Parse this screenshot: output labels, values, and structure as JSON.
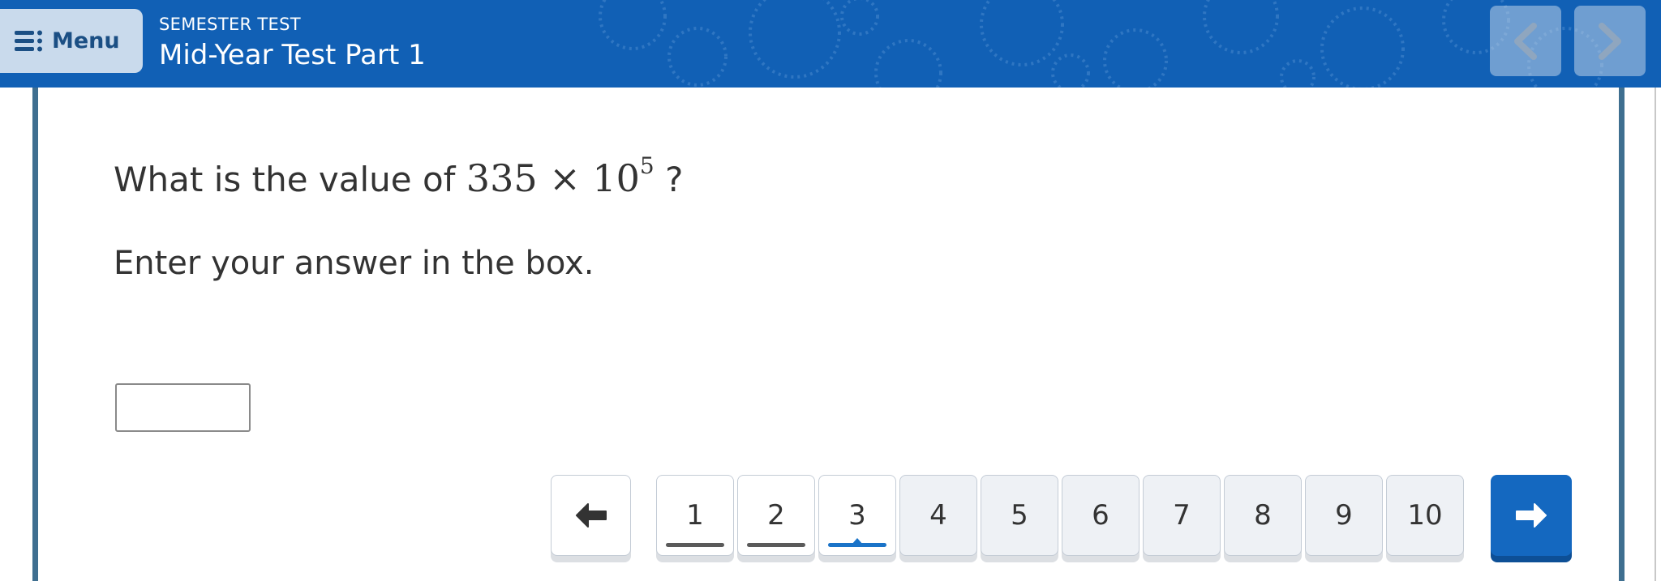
{
  "header": {
    "menu_label": "Menu",
    "test_kind": "SEMESTER TEST",
    "test_title": "Mid-Year Test Part 1",
    "prev_icon": "chevron-left-icon",
    "next_icon": "chevron-right-icon"
  },
  "question": {
    "prompt": "What is the value of",
    "math_base": "335 × 10",
    "math_exponent": "5",
    "question_mark": "?",
    "instruction": "Enter your answer in the box.",
    "answer_value": ""
  },
  "pager": {
    "pages": [
      "1",
      "2",
      "3",
      "4",
      "5",
      "6",
      "7",
      "8",
      "9",
      "10"
    ],
    "visited": [
      1,
      2,
      3
    ],
    "current": 3,
    "prev_icon": "arrow-left-icon",
    "next_icon": "arrow-right-icon"
  },
  "colors": {
    "header_bg": "#1160b5",
    "accent": "#1a73c8",
    "next_button": "#1468c0"
  }
}
